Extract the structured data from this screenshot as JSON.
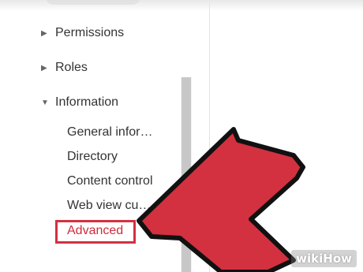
{
  "sidebar": {
    "sections": [
      {
        "label": "Permissions",
        "icon": "triangle-right-icon"
      },
      {
        "label": "Roles",
        "icon": "triangle-right-icon"
      },
      {
        "label": "Information",
        "icon": "triangle-down-icon"
      }
    ],
    "information_items": [
      "General infor…",
      "Directory",
      "Content control",
      "Web view cu…",
      "Advanced"
    ]
  },
  "annotation": {
    "arrow_color": "#d3313f",
    "highlight_color": "#d3313f"
  },
  "watermark": {
    "text": "wikiHow"
  }
}
